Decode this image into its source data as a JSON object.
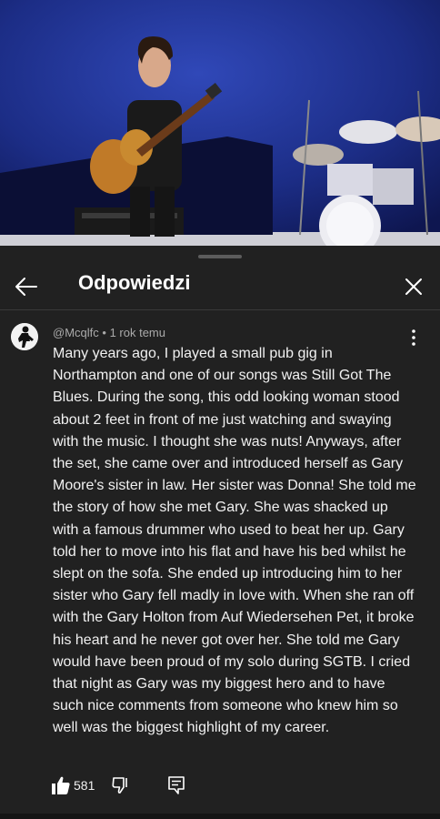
{
  "header": {
    "title": "Odpowiedzi"
  },
  "comment": {
    "author": "@Mcqlfc",
    "separator": "•",
    "time": "1 rok temu",
    "text": "Many years ago, I played a small pub gig in Northampton and one of our songs was Still Got The Blues. During the song, this odd looking woman stood about 2 feet in front of me just watching and swaying with the music. I thought she was nuts! Anyways, after the set, she came over and introduced herself as Gary Moore's sister in law. Her sister was Donna! She told me the story of how she met Gary. She was shacked up with a famous drummer who used to beat her up. Gary told her to move into his flat and have his bed whilst he slept on the sofa. She ended up introducing him to her sister who Gary fell madly in love with. When she ran off with the Gary Holton from Auf Wiedersehen Pet, it broke his heart and he never got over her. She told me Gary would have been proud of my solo during SGTB. I cried that night as Gary was my biggest hero and to have such nice comments from someone who knew him so well was the biggest highlight of my career.",
    "likes": "581"
  },
  "colors": {
    "background": "#212121",
    "text": "#f1f1f1",
    "secondary_text": "#aaaaaa",
    "video_stage": "#1b2a6e"
  },
  "icons": [
    "back-arrow-icon",
    "close-icon",
    "more-vert-icon",
    "thumb-up-icon",
    "thumb-down-icon",
    "reply-icon"
  ]
}
